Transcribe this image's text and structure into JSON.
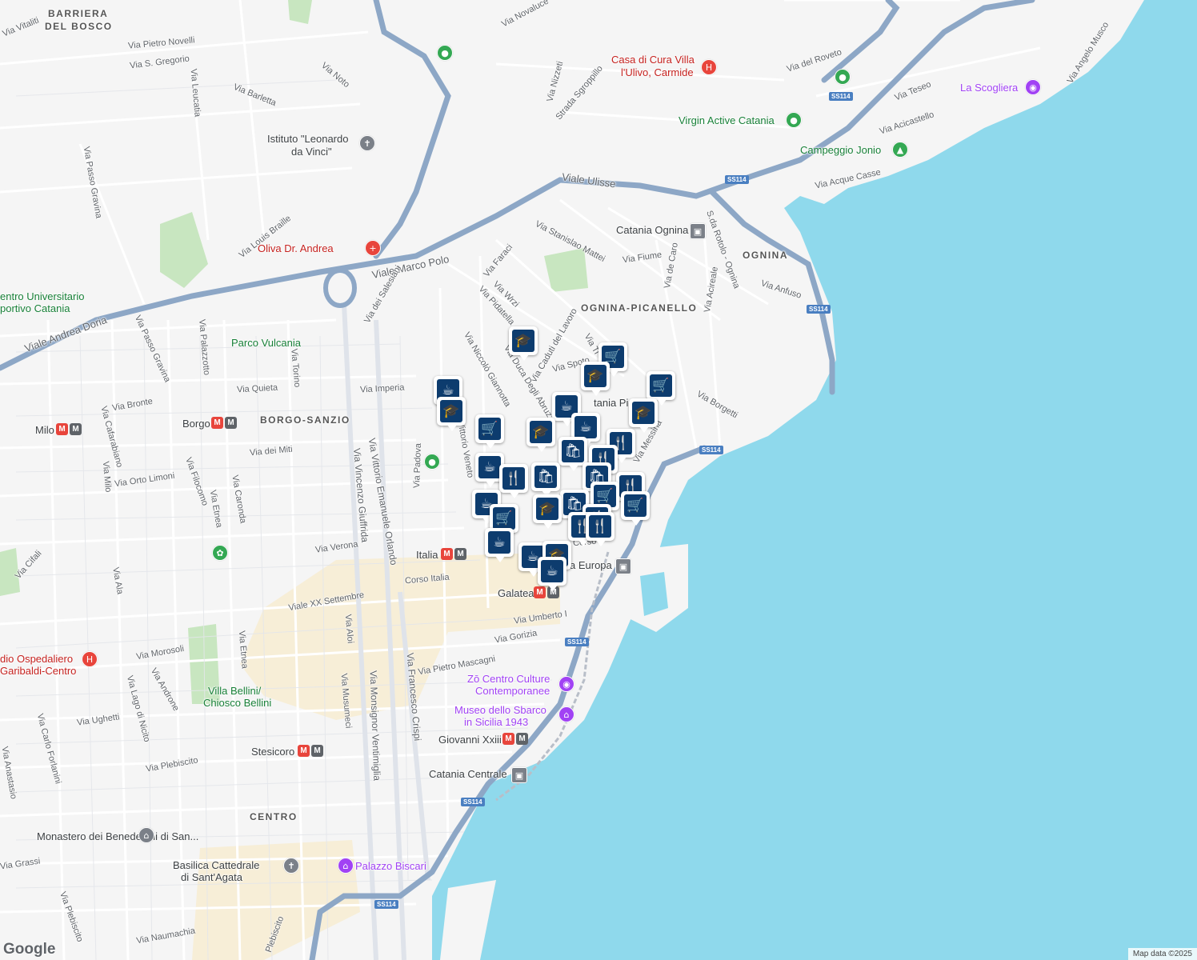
{
  "colors": {
    "water": "#8fd9ec",
    "land": "#f5f5f5",
    "road": "#ffffff",
    "highway": "#8da7c6",
    "park": "#c8e6c0",
    "pin": "#0d3c6e",
    "beige": "#f8ecd0"
  },
  "districts": [
    {
      "id": "barriera-1",
      "text": "BARRIERA"
    },
    {
      "id": "barriera-2",
      "text": "DEL BOSCO"
    },
    {
      "id": "borgo-sanzio",
      "text": "BORGO-SANZIO"
    },
    {
      "id": "ognina-picanello",
      "text": "OGNINA-PICANELLO"
    },
    {
      "id": "ognina",
      "text": "OGNINA"
    },
    {
      "id": "centro",
      "text": "CENTRO"
    }
  ],
  "streets": [
    {
      "id": "vitaliti",
      "text": "Via Vitaliti"
    },
    {
      "id": "novelli",
      "text": "Via Pietro Novelli"
    },
    {
      "id": "novaluce",
      "text": "Via Novaluce"
    },
    {
      "id": "sgregorio",
      "text": "Via S. Gregorio"
    },
    {
      "id": "leucatia",
      "text": "Via Leucatia"
    },
    {
      "id": "noto",
      "text": "Via Noto"
    },
    {
      "id": "barletta",
      "text": "Via Barletta"
    },
    {
      "id": "nizzeti",
      "text": "Via Nizzeti"
    },
    {
      "id": "sgroppillo",
      "text": "Strada Sgroppillo"
    },
    {
      "id": "roveto",
      "text": "Via del Roveto"
    },
    {
      "id": "teseo",
      "text": "Via Teseo"
    },
    {
      "id": "angelo-musco",
      "text": "Via Angelo Musco"
    },
    {
      "id": "acicastello",
      "text": "Via Acicastello"
    },
    {
      "id": "acque-casse",
      "text": "Via Acque Casse"
    },
    {
      "id": "passo-gravina-1",
      "text": "Via Passo Gravina"
    },
    {
      "id": "ulisse",
      "text": "Viale Ulisse"
    },
    {
      "id": "braille",
      "text": "Via Louis Braille"
    },
    {
      "id": "marco-polo",
      "text": "Viale Marco Polo"
    },
    {
      "id": "stanislao",
      "text": "Via Stanislao Mattei"
    },
    {
      "id": "fiume",
      "text": "Via Fiume"
    },
    {
      "id": "de-caro",
      "text": "Via de Caro"
    },
    {
      "id": "rotolo",
      "text": "S.da Rotolo - Ognina"
    },
    {
      "id": "acireale",
      "text": "Via Acireale"
    },
    {
      "id": "anfuso",
      "text": "Via Anfuso"
    },
    {
      "id": "andrea-doria",
      "text": "Viale Andrea Doria"
    },
    {
      "id": "salesiani",
      "text": "Via dei Salesiani"
    },
    {
      "id": "faraci",
      "text": "Via Faraci"
    },
    {
      "id": "wrzi",
      "text": "Via Wrzi"
    },
    {
      "id": "pidatella",
      "text": "Via Pidatella"
    },
    {
      "id": "caduti",
      "text": "Via Caduti del Lavoro"
    },
    {
      "id": "passo-gravina-2",
      "text": "Via Passo Gravina"
    },
    {
      "id": "palazzotto",
      "text": "Via Palazzotto"
    },
    {
      "id": "torino",
      "text": "Via Torino"
    },
    {
      "id": "giannotta",
      "text": "Via Niccolò Giannotta"
    },
    {
      "id": "duca",
      "text": "Via Duca Degli Abruzzi"
    },
    {
      "id": "spoto",
      "text": "Via Spoto"
    },
    {
      "id": "ti",
      "text": "Via Ti"
    },
    {
      "id": "quieta",
      "text": "Via Quieta"
    },
    {
      "id": "imperia",
      "text": "Via Imperia"
    },
    {
      "id": "bronte",
      "text": "Via Bronte"
    },
    {
      "id": "borgetti",
      "text": "Via Borgetti"
    },
    {
      "id": "cafarabiano",
      "text": "Via Cafarabiano"
    },
    {
      "id": "miti",
      "text": "Via dei Miti"
    },
    {
      "id": "padova",
      "text": "Via Padova"
    },
    {
      "id": "veneto",
      "text": "Vittorio Veneto"
    },
    {
      "id": "messina",
      "text": "Via Messina"
    },
    {
      "id": "milo",
      "text": "Via Milo"
    },
    {
      "id": "orto-limoni",
      "text": "Via Orto Limoni"
    },
    {
      "id": "filocomo",
      "text": "Via Filocomo"
    },
    {
      "id": "caronda",
      "text": "Via Caronda"
    },
    {
      "id": "etnea-1",
      "text": "Via Etnea"
    },
    {
      "id": "giuffrida",
      "text": "Via Vincenzo Giuffrida"
    },
    {
      "id": "orlando",
      "text": "Via Vittorio Emanuele Orlando"
    },
    {
      "id": "cifali",
      "text": "Via Cifali"
    },
    {
      "id": "ala",
      "text": "Via Ala"
    },
    {
      "id": "verona",
      "text": "Via Verona"
    },
    {
      "id": "corso-italia",
      "text": "Corso Italia"
    },
    {
      "id": "xx-settembre",
      "text": "Viale XX Settembre"
    },
    {
      "id": "umberto",
      "text": "Via Umberto I"
    },
    {
      "id": "gorizia",
      "text": "Via Gorizia"
    },
    {
      "id": "morosoli",
      "text": "Via Morosoli"
    },
    {
      "id": "aloi",
      "text": "Via Aloi"
    },
    {
      "id": "etnea-2",
      "text": "Via Etnea"
    },
    {
      "id": "mascagni",
      "text": "Via Pietro Mascagni"
    },
    {
      "id": "androne",
      "text": "Via Androne"
    },
    {
      "id": "lago-nicito",
      "text": "Via Lago di Nicito"
    },
    {
      "id": "ughetti",
      "text": "Via Ughetti"
    },
    {
      "id": "carlo-forlanini",
      "text": "Via Carlo Forlanini"
    },
    {
      "id": "musumeci",
      "text": "Via Musumeci"
    },
    {
      "id": "ventimiglia",
      "text": "Via Monsignor Ventimiglia"
    },
    {
      "id": "crispi",
      "text": "Via Francesco Crispi"
    },
    {
      "id": "anastasio",
      "text": "Via Anastasio"
    },
    {
      "id": "plebiscito-1",
      "text": "Via Plebiscito"
    },
    {
      "id": "grassi",
      "text": "Via Grassi"
    },
    {
      "id": "plebiscito-2",
      "text": "Via Plebiscito"
    },
    {
      "id": "naumachia",
      "text": "Via Naumachia"
    },
    {
      "id": "plebiscito-3",
      "text": "Plebiscito"
    },
    {
      "id": "corso-partial",
      "text": "Corso"
    }
  ],
  "pois": [
    {
      "id": "casa-cura-1",
      "text": "Casa di Cura Villa",
      "kind": "red"
    },
    {
      "id": "casa-cura-2",
      "text": "l'Ulivo, Carmide",
      "kind": "red"
    },
    {
      "id": "scogliera",
      "text": "La Scogliera",
      "kind": "purple"
    },
    {
      "id": "virgin",
      "text": "Virgin Active Catania",
      "kind": "green"
    },
    {
      "id": "campeggio",
      "text": "Campeggio Jonio",
      "kind": "green"
    },
    {
      "id": "leonardo-1",
      "text": "Istituto \"Leonardo",
      "kind": "gray"
    },
    {
      "id": "leonardo-2",
      "text": "da Vinci\"",
      "kind": "gray"
    },
    {
      "id": "oliva",
      "text": "Oliva Dr. Andrea",
      "kind": "red"
    },
    {
      "id": "ognina-station",
      "text": "Catania Ognina",
      "kind": "gray"
    },
    {
      "id": "centro-univ-1",
      "text": "entro Universitario",
      "kind": "green"
    },
    {
      "id": "centro-univ-2",
      "text": "portivo Catania",
      "kind": "green"
    },
    {
      "id": "vulcania",
      "text": "Parco Vulcania",
      "kind": "green"
    },
    {
      "id": "borgo",
      "text": "Borgo",
      "kind": "gray"
    },
    {
      "id": "milo-metro",
      "text": "Milo",
      "kind": "gray"
    },
    {
      "id": "picanello-station",
      "text": "tania Pica",
      "kind": "gray"
    },
    {
      "id": "italia-metro",
      "text": "Italia",
      "kind": "gray"
    },
    {
      "id": "europa",
      "text": "a Europa",
      "kind": "gray"
    },
    {
      "id": "galatea",
      "text": "Galatea",
      "kind": "gray"
    },
    {
      "id": "ospedaliero-1",
      "text": "dio Ospedaliero",
      "kind": "red"
    },
    {
      "id": "ospedaliero-2",
      "text": "Garibaldi-Centro",
      "kind": "red"
    },
    {
      "id": "zo-1",
      "text": "Zō Centro Culture",
      "kind": "purple"
    },
    {
      "id": "zo-2",
      "text": "Contemporanee",
      "kind": "purple"
    },
    {
      "id": "villa-bellini-1",
      "text": "Villa Bellini/",
      "kind": "green"
    },
    {
      "id": "villa-bellini-2",
      "text": "Chiosco Bellini",
      "kind": "green"
    },
    {
      "id": "sbarco-1",
      "text": "Museo dello Sbarco",
      "kind": "purple"
    },
    {
      "id": "sbarco-2",
      "text": "in Sicilia 1943",
      "kind": "purple"
    },
    {
      "id": "giovanni",
      "text": "Giovanni Xxiii",
      "kind": "gray"
    },
    {
      "id": "stesicoro",
      "text": "Stesicoro",
      "kind": "gray"
    },
    {
      "id": "centrale",
      "text": "Catania Centrale",
      "kind": "gray"
    },
    {
      "id": "benedettini",
      "text": "Monastero dei Benedettini di San...",
      "kind": "gray"
    },
    {
      "id": "cattedrale-1",
      "text": "Basilica Cattedrale",
      "kind": "gray"
    },
    {
      "id": "cattedrale-2",
      "text": "di Sant'Agata",
      "kind": "gray"
    },
    {
      "id": "biscari",
      "text": "Palazzo Biscari",
      "kind": "purple"
    }
  ],
  "shields": [
    "SS114",
    "SS114",
    "SS114",
    "SS114",
    "SS114",
    "SS114"
  ],
  "pins": [
    {
      "icon": "coffee-icon",
      "glyph": "☕"
    },
    {
      "icon": "graduation-icon",
      "glyph": "🎓"
    },
    {
      "icon": "cart-icon",
      "glyph": "🛒"
    },
    {
      "icon": "graduation-icon",
      "glyph": "🎓"
    },
    {
      "icon": "cart-icon",
      "glyph": "🛒"
    },
    {
      "icon": "graduation-icon",
      "glyph": "🎓"
    },
    {
      "icon": "cart-icon",
      "glyph": "🛒"
    },
    {
      "icon": "coffee-icon",
      "glyph": "☕"
    },
    {
      "icon": "graduation-icon",
      "glyph": "🎓"
    },
    {
      "icon": "coffee-icon",
      "glyph": "☕"
    },
    {
      "icon": "cart-icon",
      "glyph": "🛒"
    },
    {
      "icon": "graduation-icon",
      "glyph": "🎓"
    },
    {
      "icon": "cutlery-icon",
      "glyph": "🍴"
    },
    {
      "icon": "shopping-bag-icon",
      "glyph": "🛍"
    },
    {
      "icon": "cutlery-icon",
      "glyph": "🍴"
    },
    {
      "icon": "coffee-icon",
      "glyph": "☕"
    },
    {
      "icon": "cutlery-icon",
      "glyph": "🍴"
    },
    {
      "icon": "shopping-bag-icon",
      "glyph": "🛍"
    },
    {
      "icon": "shopping-bag-icon",
      "glyph": "🛍"
    },
    {
      "icon": "cutlery-icon",
      "glyph": "🍴"
    },
    {
      "icon": "cart-icon",
      "glyph": "🛒"
    },
    {
      "icon": "cutlery-icon",
      "glyph": "🍴"
    },
    {
      "icon": "coffee-icon",
      "glyph": "☕"
    },
    {
      "icon": "cart-icon",
      "glyph": "🛒"
    },
    {
      "icon": "graduation-icon",
      "glyph": "🎓"
    },
    {
      "icon": "shopping-bag-icon",
      "glyph": "🛍"
    },
    {
      "icon": "cart-icon",
      "glyph": "🛒"
    },
    {
      "icon": "cutlery-icon",
      "glyph": "🍴"
    },
    {
      "icon": "cutlery-icon",
      "glyph": "🍴"
    },
    {
      "icon": "cart-icon",
      "glyph": "🛒"
    },
    {
      "icon": "coffee-icon",
      "glyph": "☕"
    },
    {
      "icon": "coffee-icon",
      "glyph": "☕"
    },
    {
      "icon": "graduation-icon",
      "glyph": "🎓"
    },
    {
      "icon": "coffee-icon",
      "glyph": "☕"
    }
  ],
  "attribution": "Map data ©2025",
  "logo": "Google"
}
